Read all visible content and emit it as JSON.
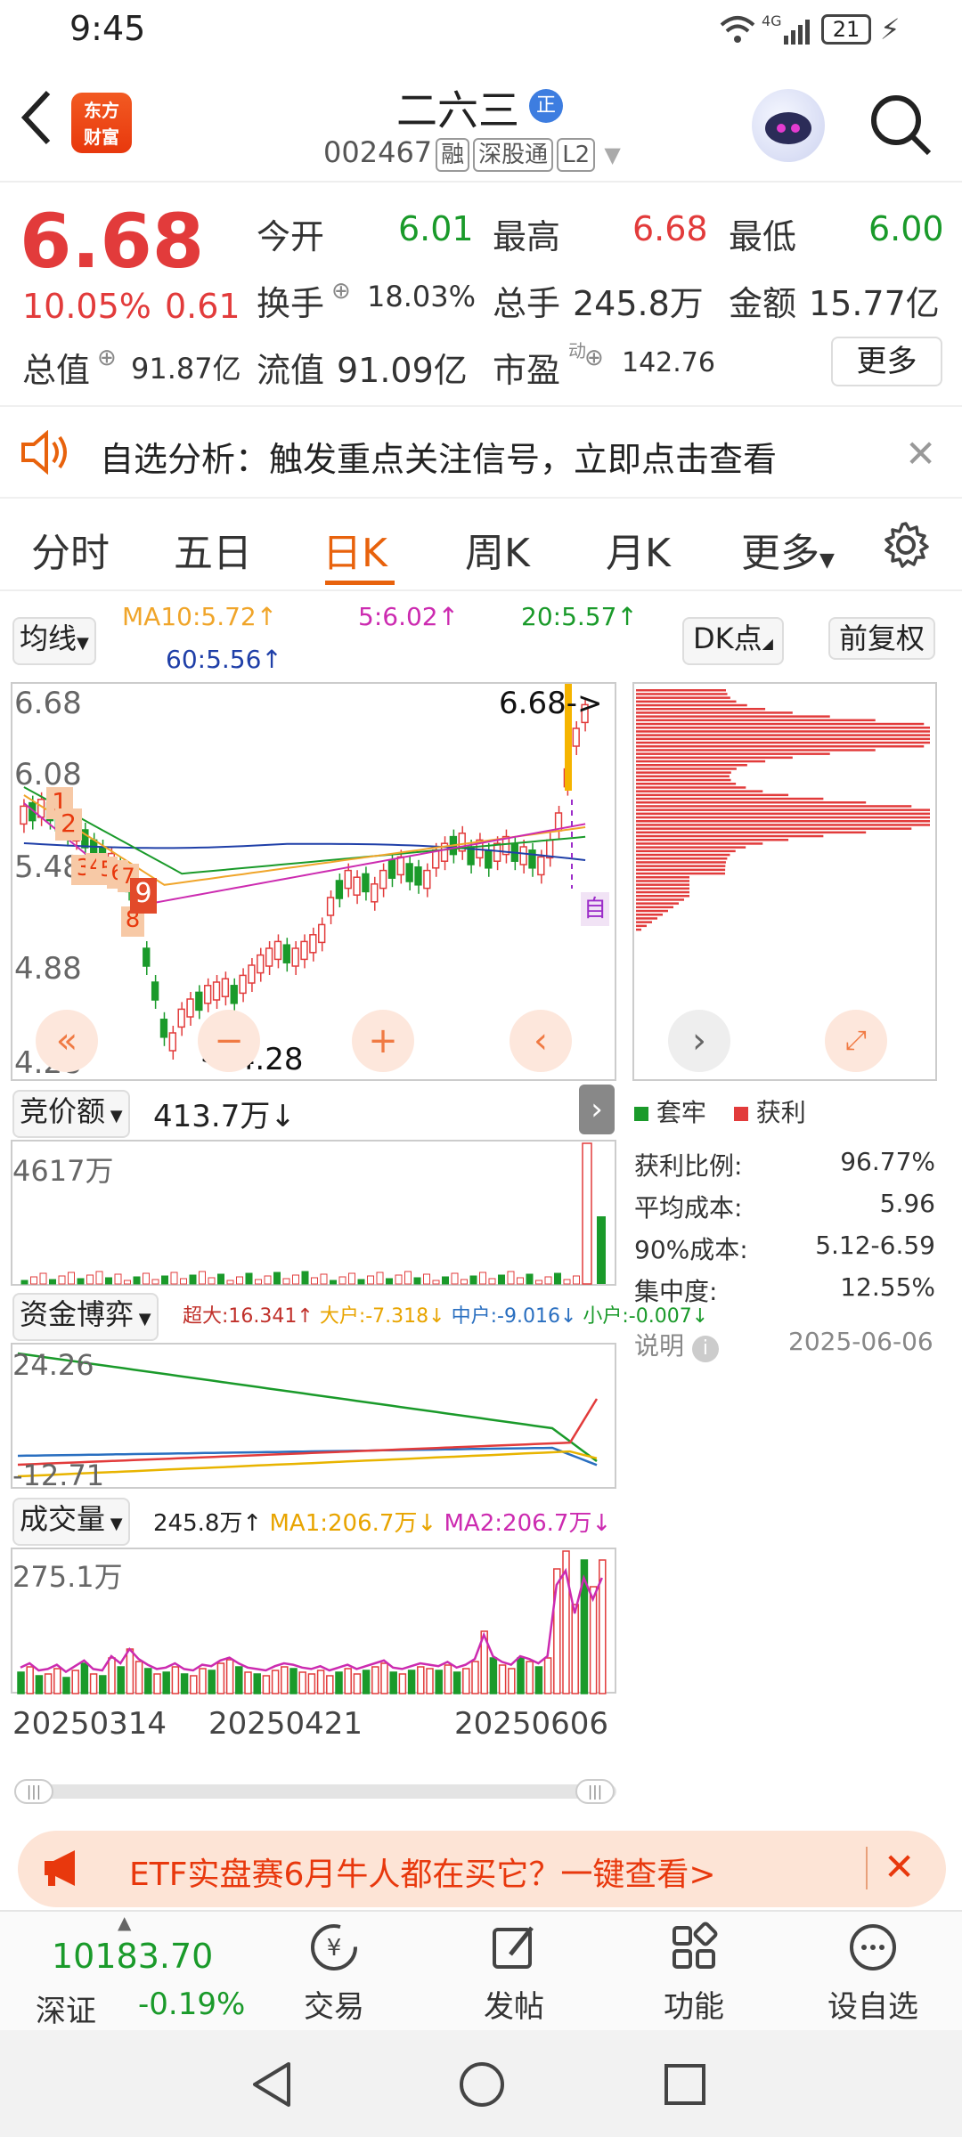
{
  "status": {
    "time": "9:45",
    "battery": "21",
    "network": "4G"
  },
  "header": {
    "logo_line1": "东方",
    "logo_line2": "财富",
    "stock_name": "二六三",
    "name_badge": "正",
    "stock_code": "002467",
    "tags": [
      "融",
      "深股通",
      "L2"
    ]
  },
  "quote": {
    "price": "6.68",
    "pct": "10.05%",
    "change": "0.61",
    "open_label": "今开",
    "open": "6.01",
    "high_label": "最高",
    "high": "6.68",
    "low_label": "最低",
    "low": "6.00",
    "turnover_label": "换手",
    "turnover": "18.03%",
    "volume_label": "总手",
    "volume": "245.8万",
    "amount_label": "金额",
    "amount": "15.77亿",
    "mktcap_label": "总值",
    "mktcap": "91.87亿",
    "float_label": "流值",
    "float": "91.09亿",
    "pe_label": "市盈",
    "pe_sup": "动",
    "pe": "142.76",
    "more_button": "更多"
  },
  "notice": {
    "text": "自选分析：触发重点关注信号，立即点击查看"
  },
  "tabs": [
    "分时",
    "五日",
    "日K",
    "周K",
    "月K",
    "更多"
  ],
  "active_tab": "日K",
  "chart_toolbar": {
    "indicator": "均线",
    "ma10": "MA10:5.72↑",
    "ma5": "5:6.02↑",
    "ma20": "20:5.57↑",
    "ma60": "60:5.56↑",
    "dk_button": "DK点",
    "adjust_button": "前复权",
    "colors": {
      "ma5": "#cc2bb0",
      "ma10": "#f0a52a",
      "ma20": "#1a9a2a",
      "ma60": "#1f3fa8"
    }
  },
  "kline": {
    "y_labels": [
      "6.68",
      "6.08",
      "5.48",
      "4.88",
      "4.28"
    ],
    "max_label": "6.68->",
    "min_label": "<-4.28",
    "markers": [
      "1",
      "2",
      "3",
      "4",
      "5",
      "6",
      "7",
      "8",
      "9"
    ],
    "auto_label": "自"
  },
  "chip_panel": {
    "legend_trapped": "套牢",
    "legend_profit": "获利",
    "rows": [
      {
        "label": "获利比例:",
        "value": "96.77%"
      },
      {
        "label": "平均成本:",
        "value": "5.96"
      },
      {
        "label": "90%成本:",
        "value": "5.12-6.59"
      },
      {
        "label": "集中度:",
        "value": "12.55%"
      }
    ],
    "note_label": "说明",
    "date": "2025-06-06"
  },
  "auction": {
    "selector": "竞价额",
    "value": "413.7万↓",
    "y_max": "4617万"
  },
  "fund_flow": {
    "selector": "资金博弈",
    "super": "超大:16.341↑",
    "large": "大户:-7.318↓",
    "medium": "中户:-9.016↓",
    "small": "小户:-0.007↓",
    "y_max": "24.26",
    "y_min": "-12.71"
  },
  "volume": {
    "selector": "成交量",
    "value": "245.8万↑",
    "ma1": "MA1:206.7万↓",
    "ma2": "MA2:206.7万↓",
    "y_max": "275.1万",
    "dates": [
      "20250314",
      "20250421",
      "20250606"
    ]
  },
  "banner": {
    "text": "ETF实盘赛6月牛人都在买它？一键查看>"
  },
  "bottom_nav": {
    "index_value": "10183.70",
    "index_name": "深证",
    "index_pct": "-0.19%",
    "items": [
      "交易",
      "发帖",
      "功能",
      "设自选"
    ]
  }
}
